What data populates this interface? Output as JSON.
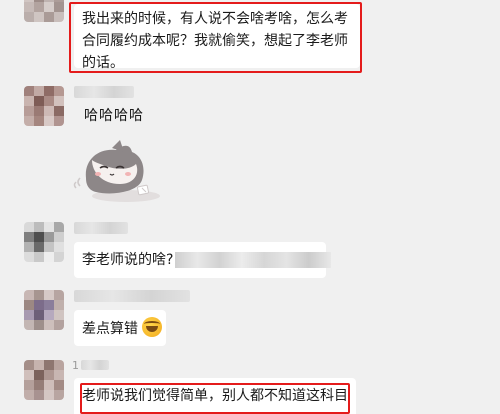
{
  "messages": [
    {
      "text": "我出来的时候，有人说不会啥考啥，怎么考合同履约成本呢？我就偷笑，想起了李老师的话。"
    },
    {
      "text": "哈哈哈哈"
    },
    {
      "sticker": "crying-cat-sticker"
    },
    {
      "text": "李老师说的啥?"
    },
    {
      "text": "差点算错"
    },
    {
      "text": "老师说我们觉得简单，别人都不知道这科目"
    }
  ],
  "sender_fragment": "1",
  "colors": {
    "highlight": "#e41b1b",
    "bubble": "#ffffff",
    "background": "#f0f0f0"
  }
}
